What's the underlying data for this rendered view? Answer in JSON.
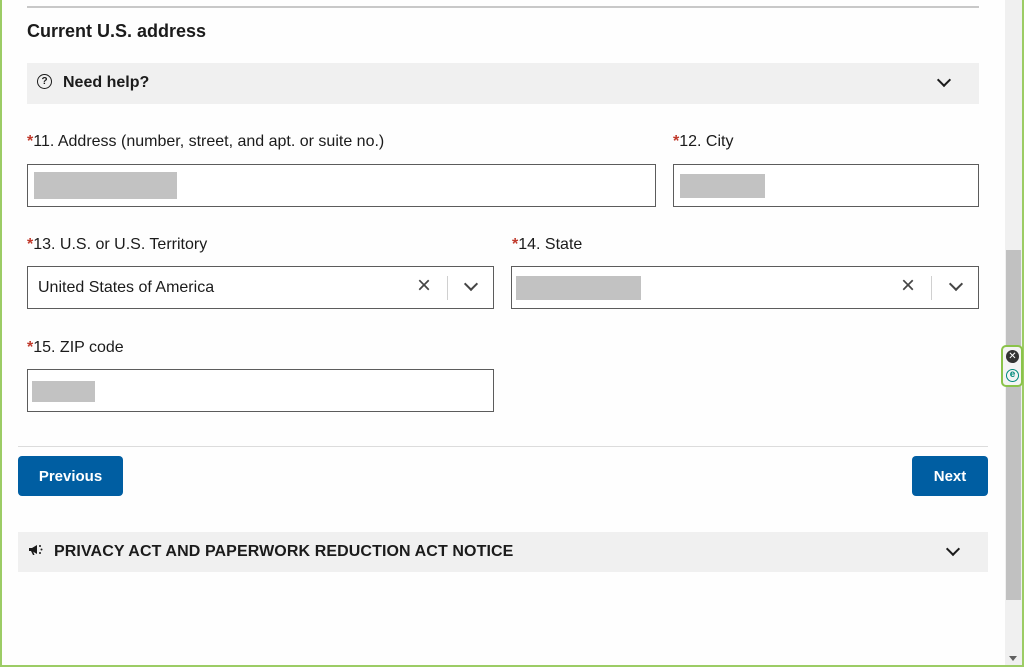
{
  "section": {
    "title": "Current U.S. address"
  },
  "help": {
    "icon": "question-circle-icon",
    "label": "Need help?",
    "expanded": false
  },
  "fields": {
    "address": {
      "required_marker": "*",
      "label": "11. Address (number, street, and apt. or suite no.)",
      "value": "[redacted]"
    },
    "city": {
      "required_marker": "*",
      "label": "12. City",
      "value": "[redacted]"
    },
    "territory": {
      "required_marker": "*",
      "label": "13. U.S. or U.S. Territory",
      "value": "United States of America"
    },
    "state": {
      "required_marker": "*",
      "label": "14. State",
      "value": "[redacted]"
    },
    "zip": {
      "required_marker": "*",
      "label": "15. ZIP code",
      "value": "[redacted]"
    }
  },
  "nav": {
    "previous_label": "Previous",
    "next_label": "Next"
  },
  "privacy": {
    "icon": "megaphone-icon",
    "label": "PRIVACY ACT AND PAPERWORK REDUCTION ACT NOTICE",
    "expanded": false
  },
  "colors": {
    "primary_button": "#005ea2",
    "required": "#c0392b",
    "accordion_bg": "#f0f0f0",
    "frame_accent": "#9ccc65"
  },
  "extension": {
    "close_glyph": "✕",
    "logo_glyph": "e"
  }
}
